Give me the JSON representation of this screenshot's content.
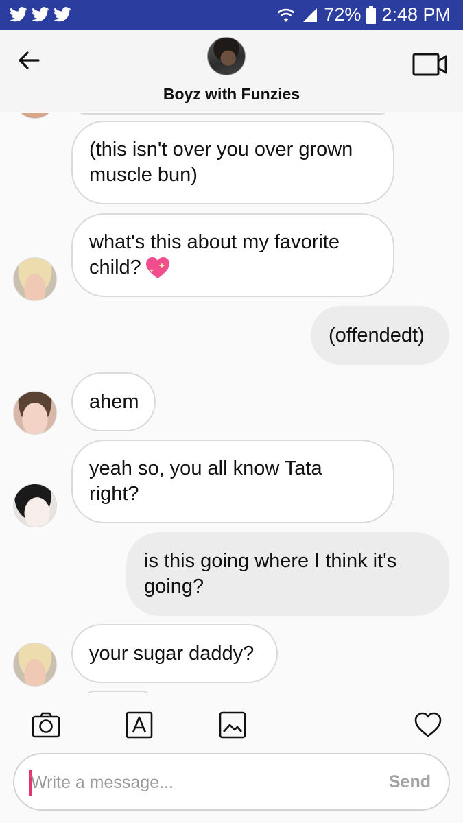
{
  "status_bar": {
    "notification_icons": [
      "twitter-icon",
      "twitter-icon",
      "twitter-icon"
    ],
    "battery": "72%",
    "time": "2:48 PM"
  },
  "header": {
    "title": "Boyz with Funzies"
  },
  "messages": [
    {
      "direction": "in",
      "text": "(this isn't over you over grown muscle bun)"
    },
    {
      "direction": "in",
      "text": "what's this about my favorite child?"
    },
    {
      "direction": "out",
      "text": "(offendedt)"
    },
    {
      "direction": "in",
      "text": "ahem"
    },
    {
      "direction": "in",
      "text": "yeah so, you all know Tata right?"
    },
    {
      "direction": "out",
      "text": "is this going where I think it's going?"
    },
    {
      "direction": "in",
      "text": "your sugar daddy?"
    }
  ],
  "composer": {
    "placeholder": "Write a message...",
    "send_label": "Send"
  },
  "colors": {
    "status_bar": "#2b3e9f",
    "incoming_bubble": "#ffffff",
    "outgoing_bubble": "#ececec",
    "caret": "#e3366f"
  }
}
